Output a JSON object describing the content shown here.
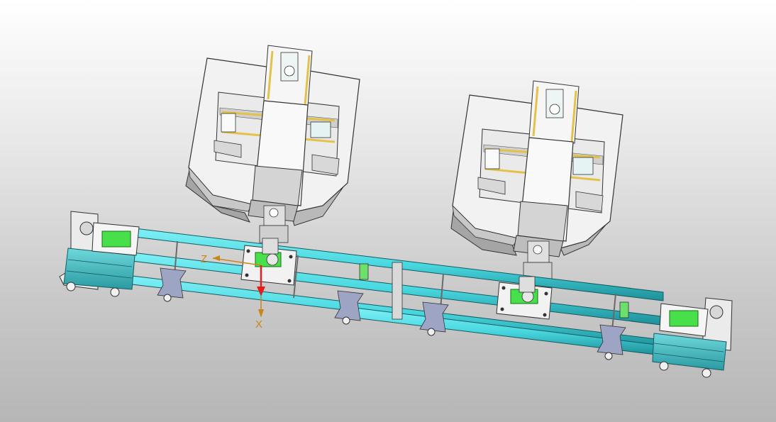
{
  "viewport": {
    "axes": {
      "z_label": "Z",
      "x_label": "X"
    }
  },
  "colors": {
    "rail": "#49d8e0",
    "rail_dark": "#1e8f98",
    "housing_light": "#f3f3f3",
    "housing_mid": "#d9d9d9",
    "housing_dark": "#a9a9a9",
    "gear_green": "#4fe04a",
    "slide_yellow": "#e4c24a",
    "bracket": "#9ea4c4",
    "axis_red": "#e02020",
    "axis_orange": "#c8861a"
  }
}
